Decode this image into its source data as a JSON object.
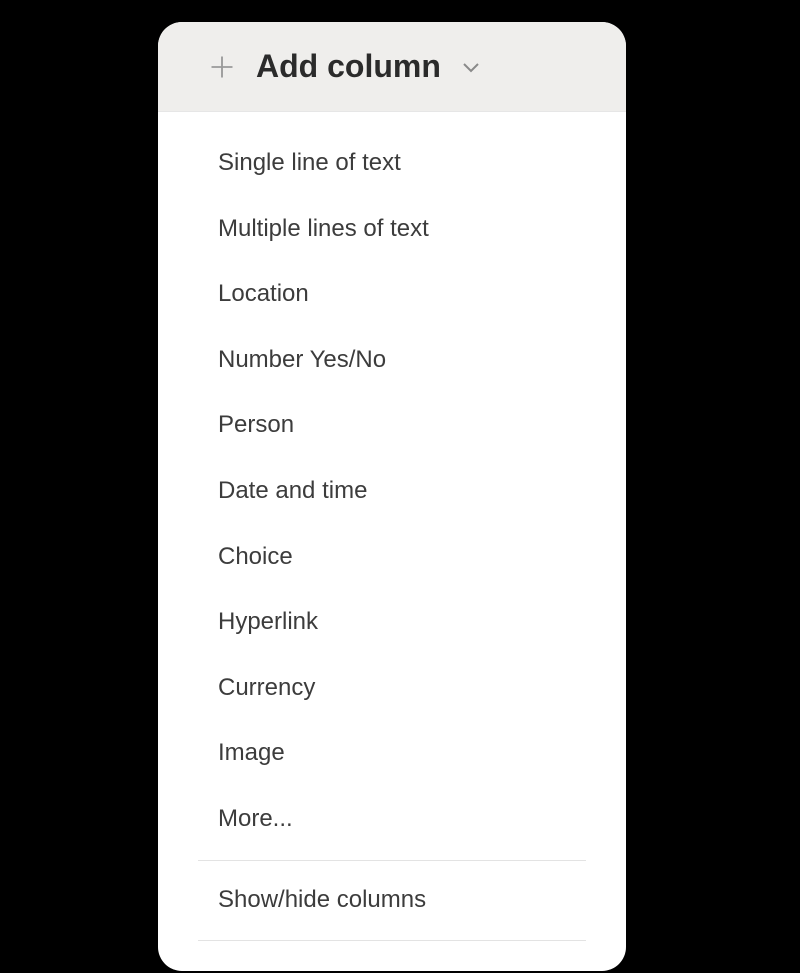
{
  "header": {
    "title": "Add column"
  },
  "menu": {
    "items": [
      "Single line of text",
      "Multiple lines of text",
      "Location",
      "Number Yes/No",
      "Person",
      "Date and time",
      "Choice",
      "Hyperlink",
      "Currency",
      "Image",
      "More..."
    ],
    "footer": "Show/hide columns"
  }
}
